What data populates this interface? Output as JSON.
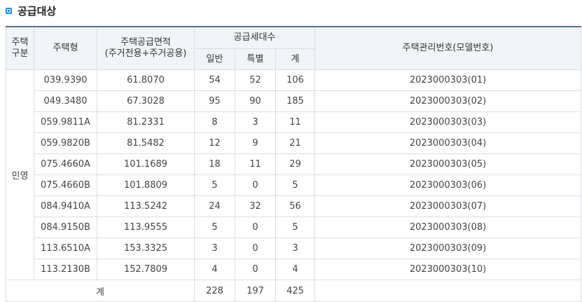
{
  "section": {
    "title": "공급대상",
    "accent_color": "#1e88e5"
  },
  "headers": {
    "type_group": [
      "주택",
      "구분"
    ],
    "housing_type": "주택형",
    "area": [
      "주택공급면적",
      "(주거전용+주거공용)"
    ],
    "households": "공급세대수",
    "general": "일반",
    "special": "특별",
    "total": "계",
    "model_no": "주택관리번호(모델번호)"
  },
  "group_label": "민영",
  "rows": [
    {
      "type": "039.9390",
      "area": "61.8070",
      "general": "54",
      "special": "52",
      "total": "106",
      "model": "2023000303(01)"
    },
    {
      "type": "049.3480",
      "area": "67.3028",
      "general": "95",
      "special": "90",
      "total": "185",
      "model": "2023000303(02)"
    },
    {
      "type": "059.9811A",
      "area": "81.2331",
      "general": "8",
      "special": "3",
      "total": "11",
      "model": "2023000303(03)"
    },
    {
      "type": "059.9820B",
      "area": "81.5482",
      "general": "12",
      "special": "9",
      "total": "21",
      "model": "2023000303(04)"
    },
    {
      "type": "075.4660A",
      "area": "101.1689",
      "general": "18",
      "special": "11",
      "total": "29",
      "model": "2023000303(05)"
    },
    {
      "type": "075.4660B",
      "area": "101.8809",
      "general": "5",
      "special": "0",
      "total": "5",
      "model": "2023000303(06)"
    },
    {
      "type": "084.9410A",
      "area": "113.5242",
      "general": "24",
      "special": "32",
      "total": "56",
      "model": "2023000303(07)"
    },
    {
      "type": "084.9150B",
      "area": "113.9555",
      "general": "5",
      "special": "0",
      "total": "5",
      "model": "2023000303(08)"
    },
    {
      "type": "113.6510A",
      "area": "153.3325",
      "general": "3",
      "special": "0",
      "total": "3",
      "model": "2023000303(09)"
    },
    {
      "type": "113.2130B",
      "area": "152.7809",
      "general": "4",
      "special": "0",
      "total": "4",
      "model": "2023000303(10)"
    }
  ],
  "totals": {
    "label": "계",
    "general": "228",
    "special": "197",
    "total": "425",
    "model": ""
  }
}
